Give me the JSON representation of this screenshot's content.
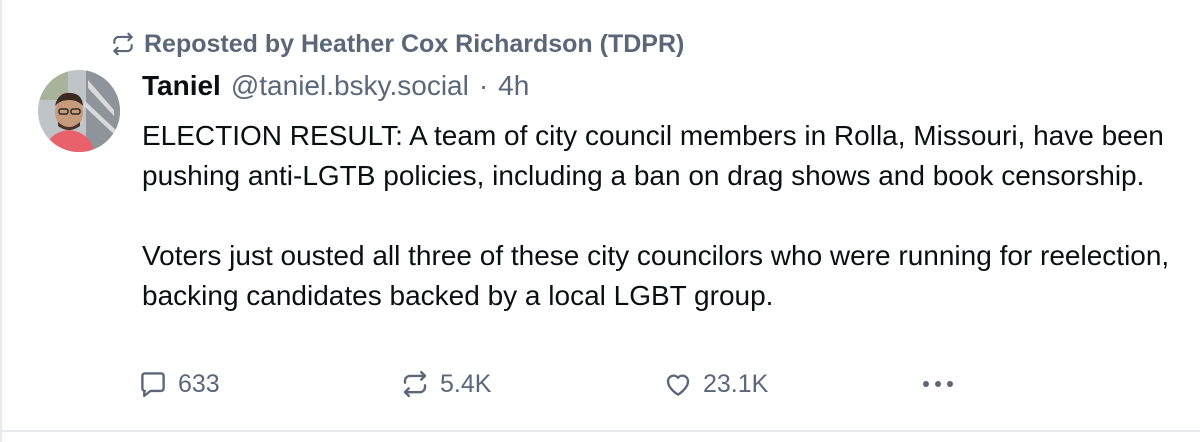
{
  "repost": {
    "label": "Reposted by Heather Cox Richardson (TDPR)",
    "icon": "repost-icon"
  },
  "author": {
    "display_name": "Taniel",
    "handle": "@taniel.bsky.social",
    "separator": "·",
    "time": "4h"
  },
  "post": {
    "paragraphs": [
      "ELECTION RESULT: A team of city council members in Rolla, Missouri, have been pushing anti-LGTB policies, including a ban on drag shows and book censorship.",
      "Voters just ousted all three of these city councilors who were running for reelection, backing candidates backed by a local LGBT group."
    ]
  },
  "actions": {
    "reply_count": "633",
    "repost_count": "5.4K",
    "like_count": "23.1K",
    "icons": [
      "reply-icon",
      "repost-icon",
      "like-icon",
      "more-icon"
    ]
  },
  "colors": {
    "text": "#0b0f14",
    "muted": "#5b6778",
    "divider": "#e6e9ee"
  }
}
